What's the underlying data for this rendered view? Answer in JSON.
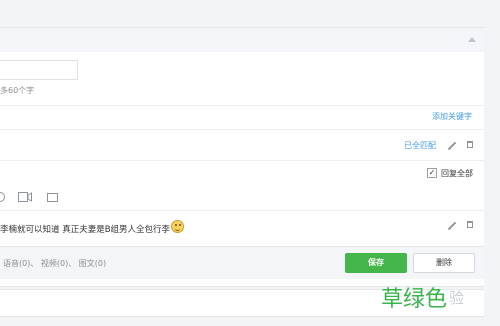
{
  "rule": {
    "name_value": "",
    "char_limit_hint": "多60个字",
    "add_keyword_label": "添加关键字",
    "match_mode_label": "已全匹配",
    "reply_all_checked": true,
    "reply_all_label": "回复全部",
    "reply_text": "李楠就可以知道 真正夫妻是B组男人全包行李",
    "stats_text": "语音(0)、 视频(0)、 图文(0)"
  },
  "actions": {
    "save_label": "保存",
    "delete_label": "删除"
  },
  "watermark": {
    "green_text": "草绿色",
    "gray_text": "验"
  },
  "colors": {
    "accent_green": "#44b549",
    "link_blue": "#459ae9"
  },
  "icons": [
    "collapse-up-icon",
    "pencil-icon",
    "trash-icon",
    "voice-icon",
    "video-icon",
    "image-icon",
    "smile-emoji-icon"
  ]
}
